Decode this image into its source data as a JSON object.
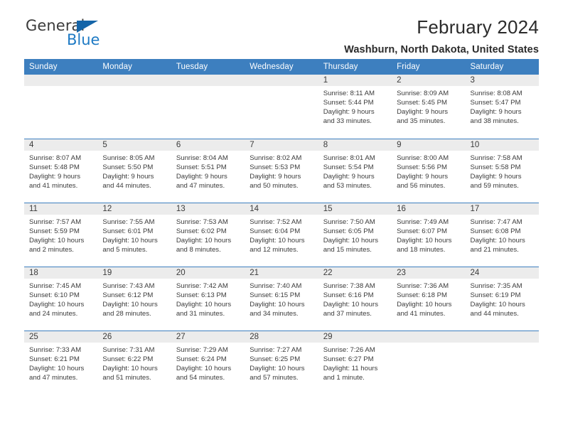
{
  "brand": {
    "name_part1": "General",
    "name_part2": "Blue",
    "triangle_icon": "triangle-icon",
    "accent_color": "#1e7ac4"
  },
  "header": {
    "title": "February 2024",
    "location": "Washburn, North Dakota, United States"
  },
  "theme": {
    "header_row_bg": "#3d7fbf",
    "daynum_bg": "#ececec",
    "text_color": "#3b3b3b"
  },
  "calendar": {
    "weekday_headers": [
      "Sunday",
      "Monday",
      "Tuesday",
      "Wednesday",
      "Thursday",
      "Friday",
      "Saturday"
    ],
    "weeks": [
      [
        {
          "day": "",
          "blank": true,
          "sunrise": "",
          "sunset": "",
          "daylight_1": "",
          "daylight_2": ""
        },
        {
          "day": "",
          "blank": true,
          "sunrise": "",
          "sunset": "",
          "daylight_1": "",
          "daylight_2": ""
        },
        {
          "day": "",
          "blank": true,
          "sunrise": "",
          "sunset": "",
          "daylight_1": "",
          "daylight_2": ""
        },
        {
          "day": "",
          "blank": true,
          "sunrise": "",
          "sunset": "",
          "daylight_1": "",
          "daylight_2": ""
        },
        {
          "day": "1",
          "blank": false,
          "sunrise": "Sunrise: 8:11 AM",
          "sunset": "Sunset: 5:44 PM",
          "daylight_1": "Daylight: 9 hours",
          "daylight_2": "and 33 minutes."
        },
        {
          "day": "2",
          "blank": false,
          "sunrise": "Sunrise: 8:09 AM",
          "sunset": "Sunset: 5:45 PM",
          "daylight_1": "Daylight: 9 hours",
          "daylight_2": "and 35 minutes."
        },
        {
          "day": "3",
          "blank": false,
          "sunrise": "Sunrise: 8:08 AM",
          "sunset": "Sunset: 5:47 PM",
          "daylight_1": "Daylight: 9 hours",
          "daylight_2": "and 38 minutes."
        }
      ],
      [
        {
          "day": "4",
          "blank": false,
          "sunrise": "Sunrise: 8:07 AM",
          "sunset": "Sunset: 5:48 PM",
          "daylight_1": "Daylight: 9 hours",
          "daylight_2": "and 41 minutes."
        },
        {
          "day": "5",
          "blank": false,
          "sunrise": "Sunrise: 8:05 AM",
          "sunset": "Sunset: 5:50 PM",
          "daylight_1": "Daylight: 9 hours",
          "daylight_2": "and 44 minutes."
        },
        {
          "day": "6",
          "blank": false,
          "sunrise": "Sunrise: 8:04 AM",
          "sunset": "Sunset: 5:51 PM",
          "daylight_1": "Daylight: 9 hours",
          "daylight_2": "and 47 minutes."
        },
        {
          "day": "7",
          "blank": false,
          "sunrise": "Sunrise: 8:02 AM",
          "sunset": "Sunset: 5:53 PM",
          "daylight_1": "Daylight: 9 hours",
          "daylight_2": "and 50 minutes."
        },
        {
          "day": "8",
          "blank": false,
          "sunrise": "Sunrise: 8:01 AM",
          "sunset": "Sunset: 5:54 PM",
          "daylight_1": "Daylight: 9 hours",
          "daylight_2": "and 53 minutes."
        },
        {
          "day": "9",
          "blank": false,
          "sunrise": "Sunrise: 8:00 AM",
          "sunset": "Sunset: 5:56 PM",
          "daylight_1": "Daylight: 9 hours",
          "daylight_2": "and 56 minutes."
        },
        {
          "day": "10",
          "blank": false,
          "sunrise": "Sunrise: 7:58 AM",
          "sunset": "Sunset: 5:58 PM",
          "daylight_1": "Daylight: 9 hours",
          "daylight_2": "and 59 minutes."
        }
      ],
      [
        {
          "day": "11",
          "blank": false,
          "sunrise": "Sunrise: 7:57 AM",
          "sunset": "Sunset: 5:59 PM",
          "daylight_1": "Daylight: 10 hours",
          "daylight_2": "and 2 minutes."
        },
        {
          "day": "12",
          "blank": false,
          "sunrise": "Sunrise: 7:55 AM",
          "sunset": "Sunset: 6:01 PM",
          "daylight_1": "Daylight: 10 hours",
          "daylight_2": "and 5 minutes."
        },
        {
          "day": "13",
          "blank": false,
          "sunrise": "Sunrise: 7:53 AM",
          "sunset": "Sunset: 6:02 PM",
          "daylight_1": "Daylight: 10 hours",
          "daylight_2": "and 8 minutes."
        },
        {
          "day": "14",
          "blank": false,
          "sunrise": "Sunrise: 7:52 AM",
          "sunset": "Sunset: 6:04 PM",
          "daylight_1": "Daylight: 10 hours",
          "daylight_2": "and 12 minutes."
        },
        {
          "day": "15",
          "blank": false,
          "sunrise": "Sunrise: 7:50 AM",
          "sunset": "Sunset: 6:05 PM",
          "daylight_1": "Daylight: 10 hours",
          "daylight_2": "and 15 minutes."
        },
        {
          "day": "16",
          "blank": false,
          "sunrise": "Sunrise: 7:49 AM",
          "sunset": "Sunset: 6:07 PM",
          "daylight_1": "Daylight: 10 hours",
          "daylight_2": "and 18 minutes."
        },
        {
          "day": "17",
          "blank": false,
          "sunrise": "Sunrise: 7:47 AM",
          "sunset": "Sunset: 6:08 PM",
          "daylight_1": "Daylight: 10 hours",
          "daylight_2": "and 21 minutes."
        }
      ],
      [
        {
          "day": "18",
          "blank": false,
          "sunrise": "Sunrise: 7:45 AM",
          "sunset": "Sunset: 6:10 PM",
          "daylight_1": "Daylight: 10 hours",
          "daylight_2": "and 24 minutes."
        },
        {
          "day": "19",
          "blank": false,
          "sunrise": "Sunrise: 7:43 AM",
          "sunset": "Sunset: 6:12 PM",
          "daylight_1": "Daylight: 10 hours",
          "daylight_2": "and 28 minutes."
        },
        {
          "day": "20",
          "blank": false,
          "sunrise": "Sunrise: 7:42 AM",
          "sunset": "Sunset: 6:13 PM",
          "daylight_1": "Daylight: 10 hours",
          "daylight_2": "and 31 minutes."
        },
        {
          "day": "21",
          "blank": false,
          "sunrise": "Sunrise: 7:40 AM",
          "sunset": "Sunset: 6:15 PM",
          "daylight_1": "Daylight: 10 hours",
          "daylight_2": "and 34 minutes."
        },
        {
          "day": "22",
          "blank": false,
          "sunrise": "Sunrise: 7:38 AM",
          "sunset": "Sunset: 6:16 PM",
          "daylight_1": "Daylight: 10 hours",
          "daylight_2": "and 37 minutes."
        },
        {
          "day": "23",
          "blank": false,
          "sunrise": "Sunrise: 7:36 AM",
          "sunset": "Sunset: 6:18 PM",
          "daylight_1": "Daylight: 10 hours",
          "daylight_2": "and 41 minutes."
        },
        {
          "day": "24",
          "blank": false,
          "sunrise": "Sunrise: 7:35 AM",
          "sunset": "Sunset: 6:19 PM",
          "daylight_1": "Daylight: 10 hours",
          "daylight_2": "and 44 minutes."
        }
      ],
      [
        {
          "day": "25",
          "blank": false,
          "sunrise": "Sunrise: 7:33 AM",
          "sunset": "Sunset: 6:21 PM",
          "daylight_1": "Daylight: 10 hours",
          "daylight_2": "and 47 minutes."
        },
        {
          "day": "26",
          "blank": false,
          "sunrise": "Sunrise: 7:31 AM",
          "sunset": "Sunset: 6:22 PM",
          "daylight_1": "Daylight: 10 hours",
          "daylight_2": "and 51 minutes."
        },
        {
          "day": "27",
          "blank": false,
          "sunrise": "Sunrise: 7:29 AM",
          "sunset": "Sunset: 6:24 PM",
          "daylight_1": "Daylight: 10 hours",
          "daylight_2": "and 54 minutes."
        },
        {
          "day": "28",
          "blank": false,
          "sunrise": "Sunrise: 7:27 AM",
          "sunset": "Sunset: 6:25 PM",
          "daylight_1": "Daylight: 10 hours",
          "daylight_2": "and 57 minutes."
        },
        {
          "day": "29",
          "blank": false,
          "sunrise": "Sunrise: 7:26 AM",
          "sunset": "Sunset: 6:27 PM",
          "daylight_1": "Daylight: 11 hours",
          "daylight_2": "and 1 minute."
        },
        {
          "day": "",
          "blank": true,
          "sunrise": "",
          "sunset": "",
          "daylight_1": "",
          "daylight_2": ""
        },
        {
          "day": "",
          "blank": true,
          "sunrise": "",
          "sunset": "",
          "daylight_1": "",
          "daylight_2": ""
        }
      ]
    ]
  }
}
